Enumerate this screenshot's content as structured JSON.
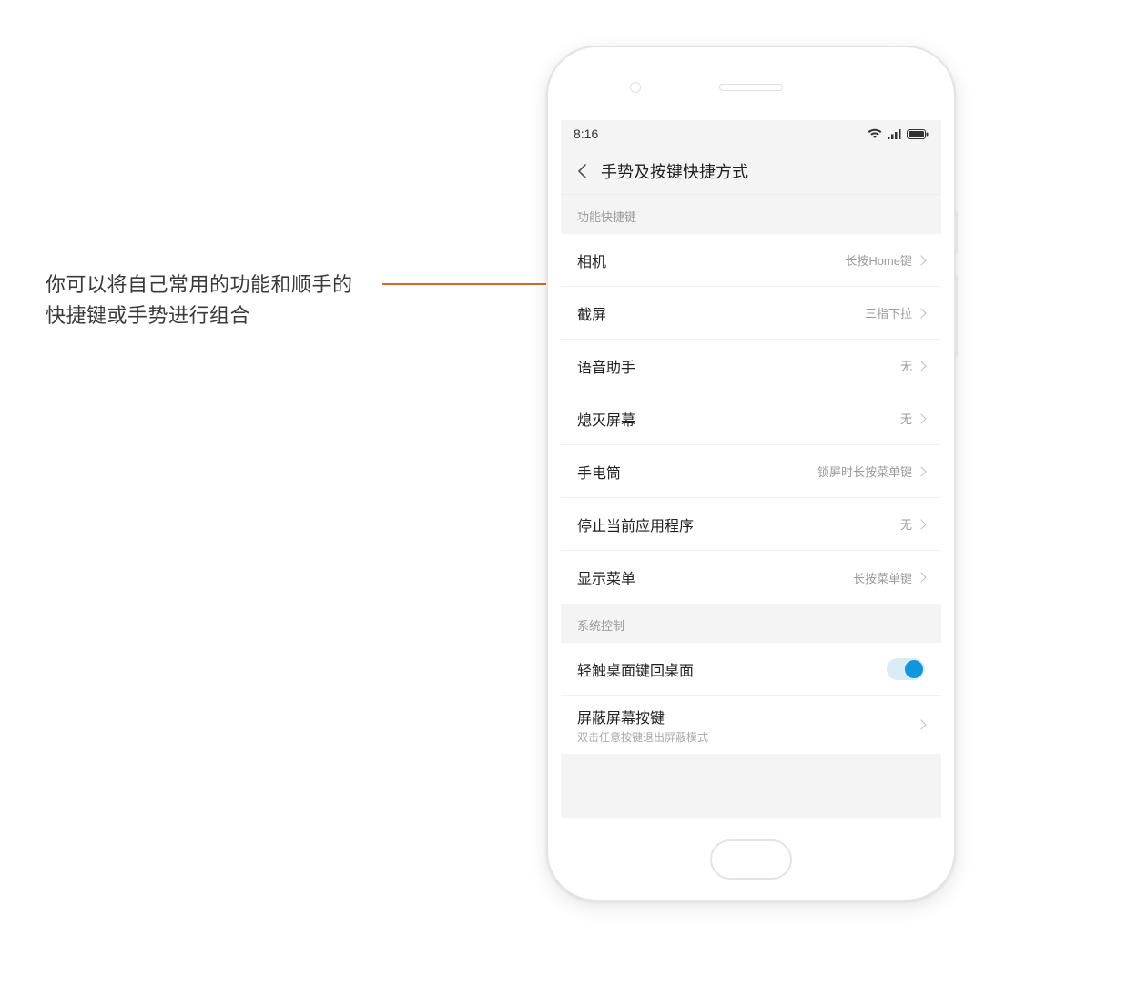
{
  "annotation": {
    "text_line1": "你可以将自己常用的功能和顺手的",
    "text_line2": "快捷键或手势进行组合"
  },
  "status": {
    "time": "8:16"
  },
  "nav": {
    "title": "手势及按键快捷方式"
  },
  "sections": [
    {
      "header": "功能快捷键",
      "items": [
        {
          "label": "相机",
          "value": "长按Home键"
        },
        {
          "label": "截屏",
          "value": "三指下拉"
        },
        {
          "label": "语音助手",
          "value": "无"
        },
        {
          "label": "熄灭屏幕",
          "value": "无"
        },
        {
          "label": "手电筒",
          "value": "锁屏时长按菜单键"
        },
        {
          "label": "停止当前应用程序",
          "value": "无"
        },
        {
          "label": "显示菜单",
          "value": "长按菜单键"
        }
      ]
    },
    {
      "header": "系统控制",
      "items_system": {
        "home_tap": {
          "label": "轻触桌面键回桌面",
          "toggle_on": true
        },
        "block_buttons": {
          "label": "屏蔽屏幕按键",
          "sub": "双击任意按键退出屏蔽模式"
        }
      }
    }
  ]
}
